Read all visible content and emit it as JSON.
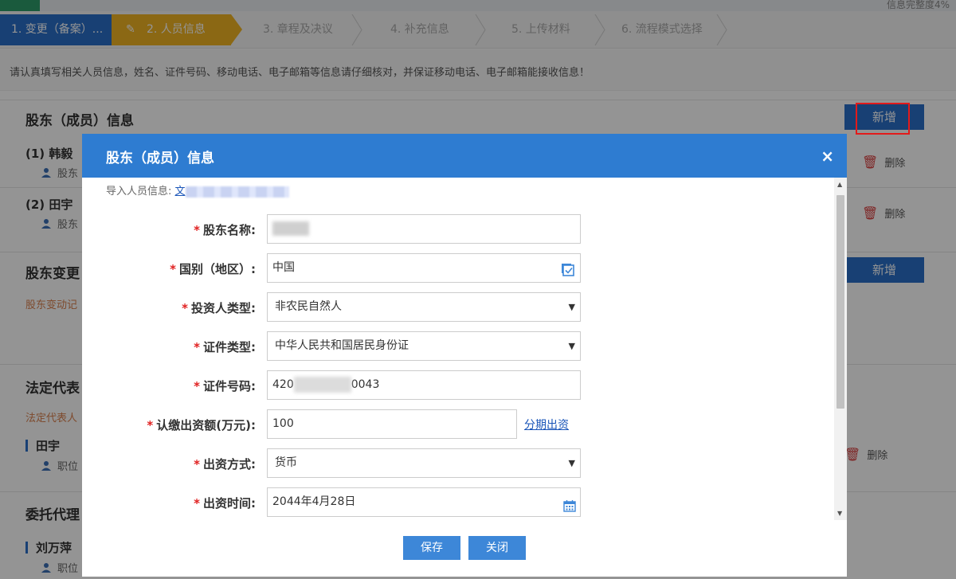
{
  "topbar": {
    "completion": "信息完整度4%"
  },
  "steps": [
    {
      "label": "1. 变更（备案）..."
    },
    {
      "label": "2. 人员信息"
    },
    {
      "label": "3. 章程及决议"
    },
    {
      "label": "4. 补充信息"
    },
    {
      "label": "5. 上传材料"
    },
    {
      "label": "6. 流程模式选择"
    }
  ],
  "notice": "请认真填写相关人员信息，姓名、证件号码、移动电话、电子邮箱等信息请仔细核对，并保证移动电话、电子邮箱能接收信息！",
  "background": {
    "shareholder_title": "股东（成员）信息",
    "add_label": "新增",
    "shareholders": [
      {
        "name": "(1) 韩毅",
        "sub": "股东"
      },
      {
        "name": "(2) 田宇",
        "sub": "股东"
      }
    ],
    "delete_label": "删除",
    "change_title": "股东变更",
    "change_hint": "股东变动记",
    "legal_title": "法定代表",
    "legal_hint": "法定代表人",
    "legal_person": {
      "name": "田宇",
      "sub": "职位"
    },
    "agent_title": "委托代理",
    "agent_person": {
      "name": "刘万萍",
      "sub": "职位"
    }
  },
  "modal": {
    "title": "股东（成员）信息",
    "close": "×",
    "import_label": "导入人员信息:",
    "import_link": "文",
    "fields": {
      "name": {
        "label": "股东名称:",
        "value": ""
      },
      "country": {
        "label": "国别（地区）:",
        "value": "中国"
      },
      "investor_type": {
        "label": "投资人类型:",
        "value": "非农民自然人"
      },
      "id_type": {
        "label": "证件类型:",
        "value": "中华人民共和国居民身份证"
      },
      "id_number": {
        "label": "证件号码:",
        "value_prefix": "420",
        "value_suffix": "0043"
      },
      "capital": {
        "label": "认缴出资额(万元):",
        "value": "100",
        "link": "分期出资"
      },
      "method": {
        "label": "出资方式:",
        "value": "货币"
      },
      "date": {
        "label": "出资时间:",
        "value": "2044年4月28日"
      }
    },
    "required_mark": "*",
    "save": "保存",
    "close_btn": "关闭"
  },
  "colors": {
    "primary": "#2e7cd1",
    "step_done": "#2a6fc9",
    "step_active": "#f0b323",
    "required": "#e02020",
    "highlight": "#e31a1a"
  }
}
